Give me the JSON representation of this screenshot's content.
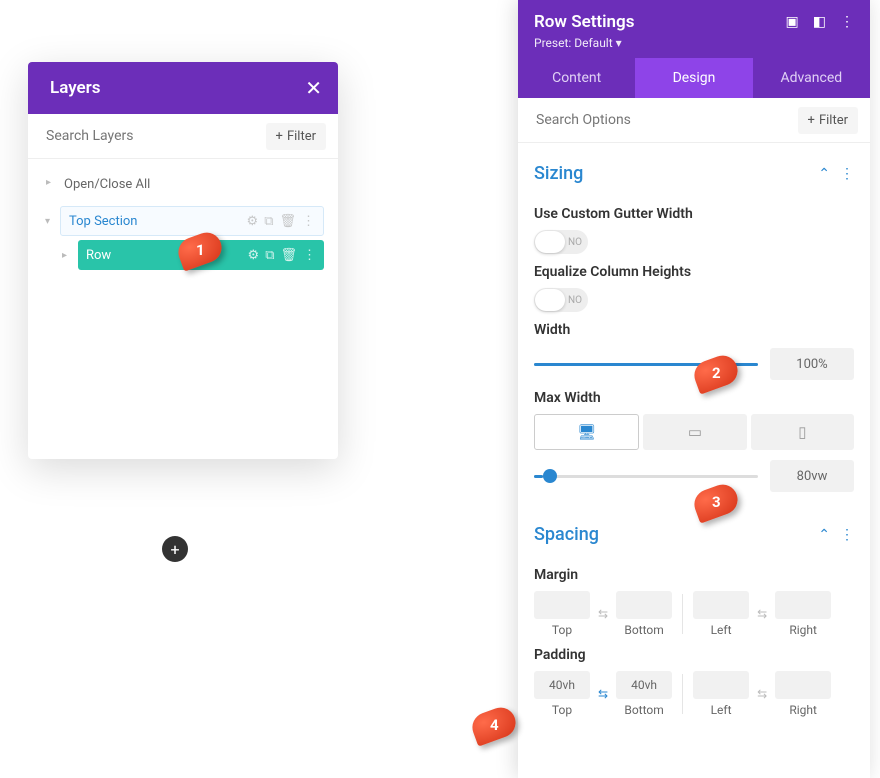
{
  "layers": {
    "title": "Layers",
    "search_placeholder": "Search Layers",
    "filter_label": "Filter",
    "open_close": "Open/Close All",
    "items": [
      {
        "label": "Top Section"
      },
      {
        "label": "Row"
      }
    ]
  },
  "settings": {
    "title": "Row Settings",
    "preset": "Preset: Default",
    "tabs": {
      "content": "Content",
      "design": "Design",
      "advanced": "Advanced"
    },
    "search_placeholder": "Search Options",
    "filter_label": "Filter",
    "sizing": {
      "title": "Sizing",
      "gutter_label": "Use Custom Gutter Width",
      "gutter_value": "NO",
      "equalize_label": "Equalize Column Heights",
      "equalize_value": "NO",
      "width_label": "Width",
      "width_value": "100%",
      "maxwidth_label": "Max Width",
      "maxwidth_value": "80vw"
    },
    "spacing": {
      "title": "Spacing",
      "margin_label": "Margin",
      "padding_label": "Padding",
      "padding_top": "40vh",
      "padding_bottom": "40vh",
      "labels": {
        "top": "Top",
        "bottom": "Bottom",
        "left": "Left",
        "right": "Right"
      }
    }
  },
  "annotations": [
    "1",
    "2",
    "3",
    "4"
  ]
}
